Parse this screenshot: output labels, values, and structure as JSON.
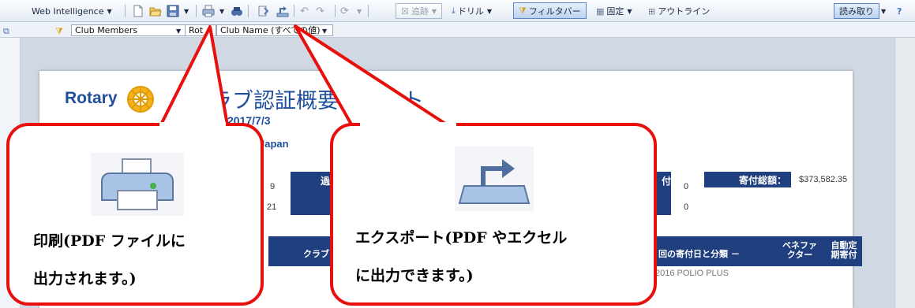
{
  "toolbar": {
    "app_menu": "Web Intelligence",
    "track": "追跡",
    "drill": "ドリル",
    "filter_bar": "フィルタバー",
    "freeze": "固定",
    "outline": "アウトライン",
    "mode": "読み取り"
  },
  "filterbar": {
    "dimension": "Club Members",
    "dimension_short": "Rot",
    "value": "Club Name (すべての値)"
  },
  "report": {
    "logo_text": "Rotary",
    "title": "クラブ認証概要レポート",
    "date": "2017/7/3",
    "country": "Japan",
    "value_9": "9",
    "value_21": "21",
    "box_left": "過",
    "box_mid": "付",
    "zero_1": "0",
    "zero_2": "0",
    "total_label": "寄付総額：",
    "total_value": "$373,582.35",
    "col_club": "クラブ",
    "col_gift_date": "回の寄付日と分類 －",
    "col_benefactor": "ベネファクター",
    "col_auto": "自動定期寄付",
    "row_partial": "2016 POLIO PLUS"
  },
  "callouts": {
    "print_line1": "印刷(PDF ファイルに",
    "print_line2": "出力されます。)",
    "export_line1": "エクスポート(PDF やエクセル",
    "export_line2": "に出力できます。)"
  },
  "colors": {
    "callout_border": "#e8100c",
    "report_blue": "#1f4e9c",
    "navy": "#1f3f7e"
  },
  "icons": [
    "new-document-icon",
    "open-folder-icon",
    "save-icon",
    "print-icon",
    "find-icon",
    "track-changes-icon",
    "export-icon",
    "undo-icon",
    "redo-icon",
    "refresh-icon",
    "drill-icon",
    "filter-icon",
    "freeze-icon",
    "outline-icon",
    "help-icon",
    "rotary-wheel-icon"
  ]
}
